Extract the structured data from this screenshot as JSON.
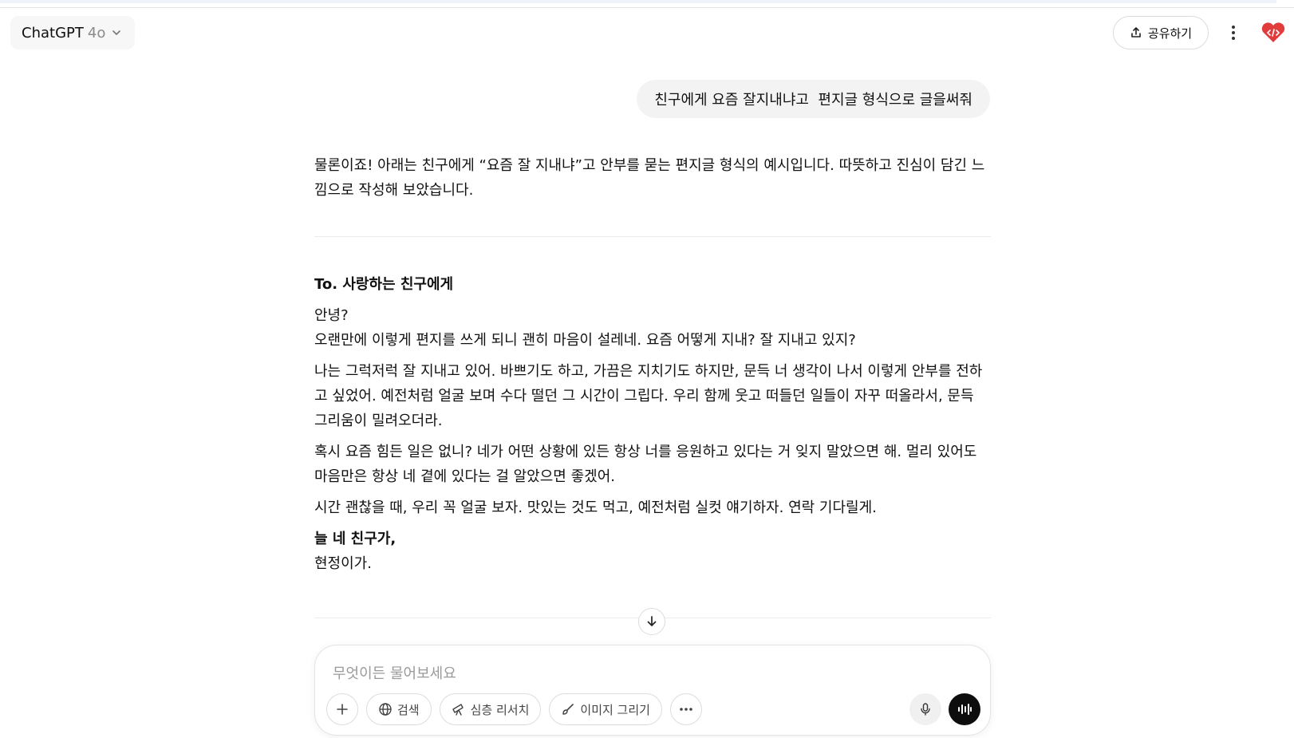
{
  "header": {
    "model_name": "ChatGPT",
    "model_version": "4o",
    "share_label": "공유하기"
  },
  "conversation": {
    "user_message": "친구에게 요즘 잘지내냐고  편지글 형식으로 글을써줘",
    "assistant_intro": "물론이죠! 아래는 친구에게 “요즘 잘 지내냐”고 안부를 묻는 편지글 형식의 예시입니다. 따뜻하고 진심이 담긴 느낌으로 작성해 보았습니다.",
    "letter": {
      "title": "To. 사랑하는 친구에게",
      "greeting": "안녕?",
      "para1": "오랜만에 이렇게 편지를 쓰게 되니 괜히 마음이 설레네. 요즘 어떻게 지내? 잘 지내고 있지?",
      "para2": "나는 그럭저럭 잘 지내고 있어. 바쁘기도 하고, 가끔은 지치기도 하지만, 문득 너 생각이 나서 이렇게 안부를 전하고 싶었어. 예전처럼 얼굴 보며 수다 떨던 그 시간이 그립다. 우리 함께 웃고 떠들던 일들이 자꾸 떠올라서, 문득 그리움이 밀려오더라.",
      "para3": "혹시 요즘 힘든 일은 없니? 네가 어떤 상황에 있든 항상 너를 응원하고 있다는 거 잊지 말았으면 해. 멀리 있어도 마음만은 항상 네 곁에 있다는 걸 알았으면 좋겠어.",
      "para4": "시간 괜찮을 때, 우리 꼭 얼굴 보자. 맛있는 것도 먹고, 예전처럼 실컷 얘기하자. 연락 기다릴게.",
      "closing": "늘 네 친구가,",
      "signature": "현정이가."
    }
  },
  "composer": {
    "placeholder": "무엇이든 물어보세요",
    "tools": {
      "search": "검색",
      "deep_research": "심층 리서치",
      "image": "이미지 그리기"
    }
  },
  "icons": {
    "model_chevron": "chevron-down-icon",
    "share": "upload-icon",
    "more": "more-vertical-icon",
    "extension": "code-extension-icon",
    "scroll": "arrow-down-icon",
    "add": "plus-icon",
    "search": "globe-icon",
    "deep_research": "telescope-icon",
    "image": "brush-icon",
    "tools_more": "more-horizontal-icon",
    "mic": "microphone-icon",
    "voice": "voice-wave-icon"
  },
  "colors": {
    "bubble_bg": "#f3f3f3",
    "voice_button": "#0d0d0d",
    "extension_accent": "#e23b3b"
  }
}
